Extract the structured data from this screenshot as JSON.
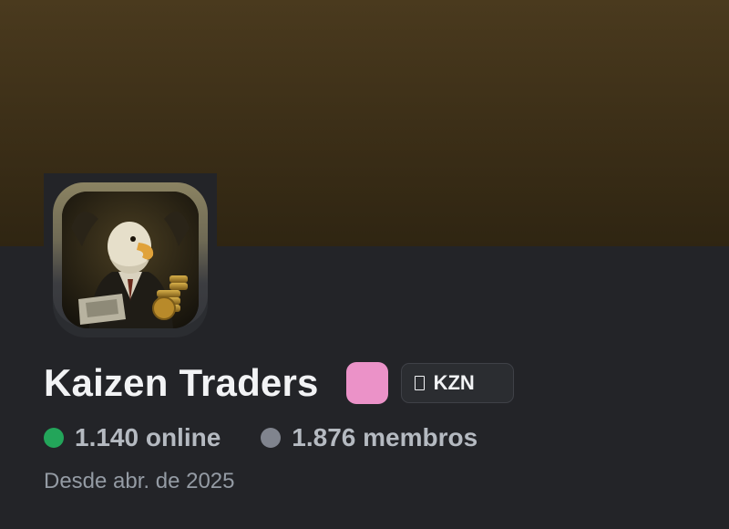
{
  "server": {
    "name": "Kaizen Traders",
    "tag": "KZN",
    "tag_icon": "tag-icon",
    "avatar_icon": "eagle-trader-avatar",
    "badge_color": "#eb92c8"
  },
  "stats": {
    "online": "1.140 online",
    "members": "1.876 membros",
    "online_color": "#23a55a",
    "members_color": "#80848e"
  },
  "since": "Desde abr. de 2025",
  "colors": {
    "banner": "#4a3a1e",
    "background": "#232428"
  }
}
